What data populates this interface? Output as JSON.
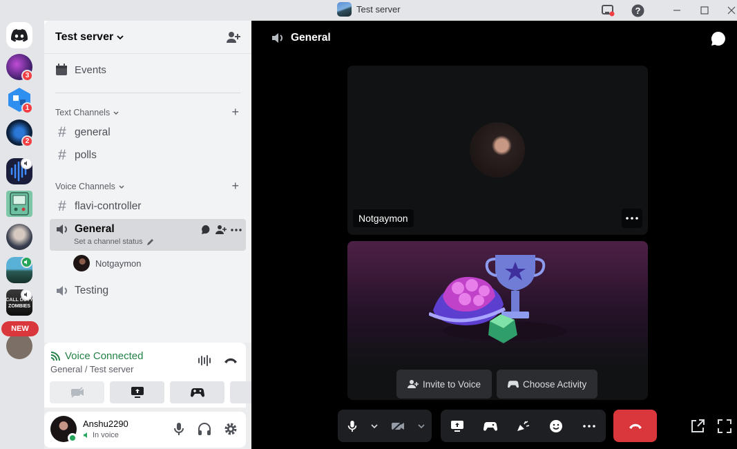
{
  "window": {
    "title": "Test server"
  },
  "server": {
    "name": "Test server",
    "events_label": "Events",
    "text_category": "Text Channels",
    "voice_category": "Voice Channels",
    "text_channels": [
      "general",
      "polls"
    ],
    "voice_channels": [
      {
        "name": "flavi-controller",
        "type": "text"
      },
      {
        "name": "General",
        "status_placeholder": "Set a channel status",
        "users": [
          "Notgaymon"
        ],
        "active": true
      },
      {
        "name": "Testing"
      }
    ]
  },
  "rail": {
    "badges": [
      "3",
      "1",
      "2"
    ],
    "new_label": "NEW"
  },
  "voice": {
    "status": "Voice Connected",
    "location": "General / Test server"
  },
  "user": {
    "name": "Anshu2290",
    "state": "In voice"
  },
  "main": {
    "channel_title": "General",
    "participant": "Notgaymon",
    "invite_label": "Invite to Voice",
    "activity_label": "Choose Activity"
  },
  "colors": {
    "connected": "#248046",
    "danger": "#da373c",
    "online": "#23a55a"
  }
}
